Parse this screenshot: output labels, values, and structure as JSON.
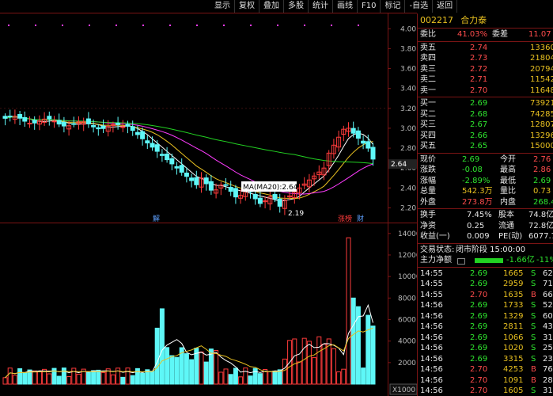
{
  "toolbar": {
    "items": [
      "显示",
      "复权",
      "叠加",
      "多股",
      "统计",
      "画线",
      "F10",
      "标记",
      "-自选",
      "返回"
    ]
  },
  "stock": {
    "code": "002217",
    "name": "合力泰"
  },
  "order_ratio": {
    "label1": "委比",
    "val1": "41.03%",
    "label2": "委差",
    "val2": "11.07"
  },
  "asks": [
    {
      "label": "卖五",
      "price": "2.74",
      "vol": "13360"
    },
    {
      "label": "卖四",
      "price": "2.73",
      "vol": "21804"
    },
    {
      "label": "卖三",
      "price": "2.72",
      "vol": "20794"
    },
    {
      "label": "卖二",
      "price": "2.71",
      "vol": "11542"
    },
    {
      "label": "卖一",
      "price": "2.70",
      "vol": "11648"
    }
  ],
  "bids": [
    {
      "label": "买一",
      "price": "2.69",
      "vol": "73921"
    },
    {
      "label": "买二",
      "price": "2.68",
      "vol": "74285"
    },
    {
      "label": "买三",
      "price": "2.67",
      "vol": "12807"
    },
    {
      "label": "买四",
      "price": "2.66",
      "vol": "13296"
    },
    {
      "label": "买五",
      "price": "2.65",
      "vol": "15000"
    }
  ],
  "quote": [
    {
      "l1": "现价",
      "v1": "2.69",
      "c1": "green",
      "l2": "今开",
      "v2": "2.76",
      "c2": "red"
    },
    {
      "l1": "涨跌",
      "v1": "-0.08",
      "c1": "green",
      "l2": "最高",
      "v2": "2.86",
      "c2": "red"
    },
    {
      "l1": "涨幅",
      "v1": "-2.89%",
      "c1": "green",
      "l2": "最低",
      "v2": "2.69",
      "c2": "green"
    },
    {
      "l1": "总量",
      "v1": "542.3万",
      "c1": "yellow",
      "l2": "量比",
      "v2": "0.73",
      "c2": "yellow"
    },
    {
      "l1": "外盘",
      "v1": "273.8万",
      "c1": "red",
      "l2": "内盘",
      "v2": "268.4万",
      "c2": "green"
    }
  ],
  "quote2": [
    {
      "l1": "换手",
      "v1": "7.45%",
      "l2": "股本",
      "v2": "74.8亿"
    },
    {
      "l1": "净资",
      "v1": "0.25",
      "l2": "流通",
      "v2": "72.8亿"
    },
    {
      "l1": "收益(一)",
      "v1": "0.009",
      "l2": "PE(动)",
      "v2": "6077.7"
    }
  ],
  "status": {
    "label": "交易状态:",
    "text": "闭市阶段 15:00:00"
  },
  "mainflow": {
    "label": "主力净额",
    "value": "-1.66亿",
    "pct": "-11%"
  },
  "ticks": [
    {
      "t": "14:55",
      "p": "2.69",
      "v": "1665",
      "d": "S",
      "n": "62"
    },
    {
      "t": "14:55",
      "p": "2.69",
      "v": "2959",
      "d": "S",
      "n": "71"
    },
    {
      "t": "14:55",
      "p": "2.70",
      "v": "1635",
      "d": "B",
      "n": "66"
    },
    {
      "t": "14:56",
      "p": "2.69",
      "v": "1733",
      "d": "S",
      "n": "52"
    },
    {
      "t": "14:56",
      "p": "2.69",
      "v": "1329",
      "d": "S",
      "n": "60"
    },
    {
      "t": "14:56",
      "p": "2.69",
      "v": "2811",
      "d": "S",
      "n": "43"
    },
    {
      "t": "14:56",
      "p": "2.69",
      "v": "1066",
      "d": "S",
      "n": "31"
    },
    {
      "t": "14:56",
      "p": "2.69",
      "v": "1020",
      "d": "S",
      "n": "25"
    },
    {
      "t": "14:56",
      "p": "2.69",
      "v": "3315",
      "d": "S",
      "n": "23"
    },
    {
      "t": "14:56",
      "p": "2.70",
      "v": "4253",
      "d": "B",
      "n": "76"
    },
    {
      "t": "14:56",
      "p": "2.70",
      "v": "1091",
      "d": "B",
      "n": "28"
    },
    {
      "t": "14:56",
      "p": "2.70",
      "v": "1605",
      "d": "S",
      "n": "31"
    },
    {
      "t": "14:56",
      "p": "2.69",
      "v": "6299",
      "d": "S",
      "n": "11"
    }
  ],
  "price_axis": {
    "labels": [
      "4.00",
      "3.80",
      "3.60",
      "3.40",
      "3.20",
      "3.00",
      "2.80",
      "2.60",
      "2.40",
      "2.20"
    ],
    "current": "2.64"
  },
  "vol_axis": {
    "labels": [
      "14000",
      "12000",
      "10000",
      "8000",
      "6000",
      "4000",
      "2000"
    ],
    "unit": "X1000"
  },
  "ma_label": "MA(MA20):2.64",
  "low_label": "2.19",
  "markers": {
    "jie": "解",
    "zhangbang": "涨榜",
    "cai": "财"
  },
  "colors": {
    "up": "#ff3b3b",
    "down": "#5ef7f7",
    "ma5": "#ffffff",
    "ma10": "#e8c020",
    "ma20": "#ff3cff",
    "ma60": "#22d122",
    "vol_up": "#ff3b3b",
    "vol_down": "#5ef7f7"
  }
}
